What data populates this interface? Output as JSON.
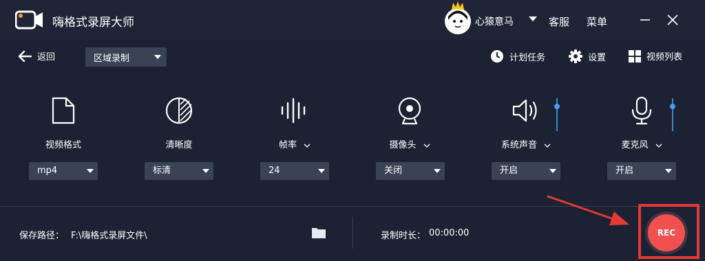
{
  "app": {
    "title": "嗨格式录屏大师"
  },
  "user": {
    "name": "心猿意马"
  },
  "titlebar": {
    "service_label": "客服",
    "menu_label": "菜单"
  },
  "toolbar": {
    "back_label": "返回",
    "mode_value": "区域录制",
    "schedule_label": "计划任务",
    "settings_label": "设置",
    "videolist_label": "视频列表"
  },
  "settings": [
    {
      "label": "视频格式",
      "value": "mp4",
      "icon": "file-icon"
    },
    {
      "label": "清晰度",
      "value": "标清",
      "icon": "clarity-icon"
    },
    {
      "label": "帧率",
      "value": "24",
      "icon": "frame-rate-icon"
    },
    {
      "label": "摄像头",
      "value": "关闭",
      "icon": "camera-icon"
    },
    {
      "label": "系统声音",
      "value": "开启",
      "icon": "speaker-icon"
    },
    {
      "label": "麦克风",
      "value": "开启",
      "icon": "microphone-icon"
    }
  ],
  "footer": {
    "save_path_label": "保存路径：",
    "save_path_value": "F:\\嗨格式录屏文件\\",
    "duration_label": "录制时长：",
    "duration_value": "00:00:00"
  },
  "rec": {
    "label": "REC"
  },
  "colors": {
    "background": "#1c2233",
    "accent": "#4a9bf0",
    "rec": "#f24f4f",
    "highlight": "#e53935"
  }
}
